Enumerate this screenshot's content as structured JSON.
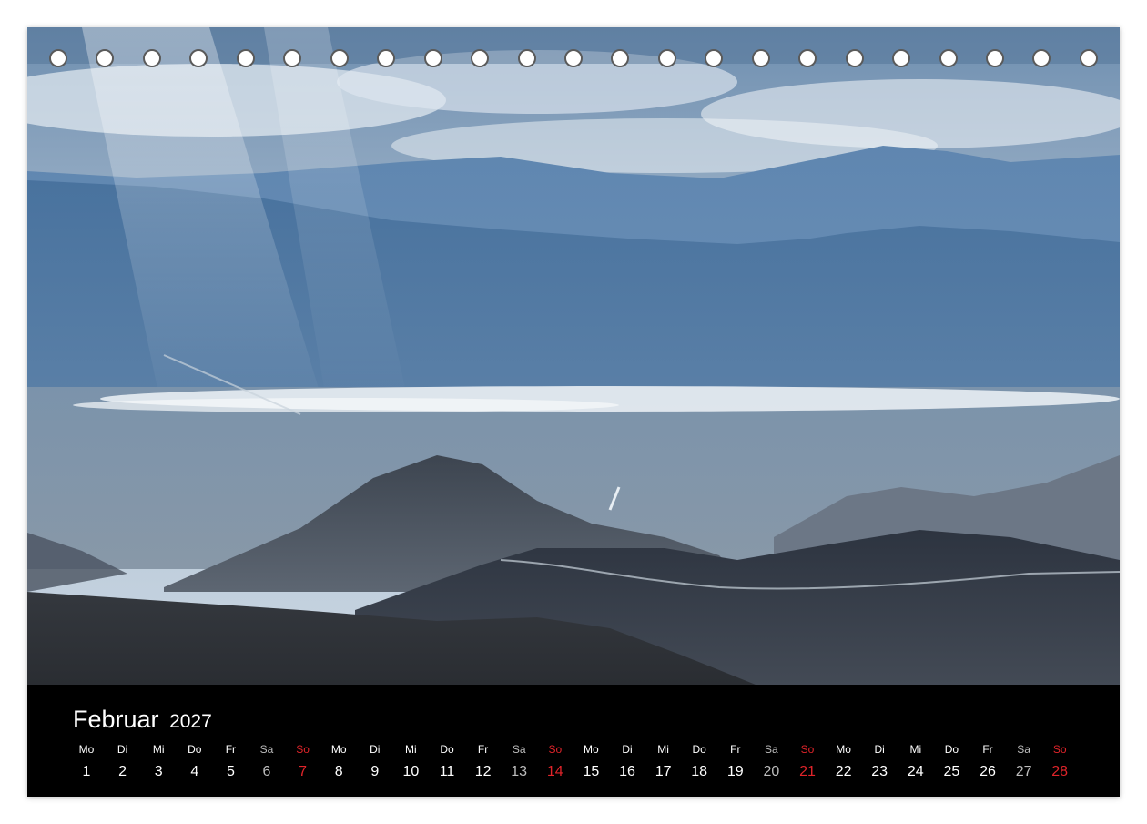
{
  "calendar": {
    "month": "Februar",
    "year": "2027",
    "colors": {
      "sunday": "#e0242a",
      "saturday": "#bdbdbd",
      "weekday": "#ffffff",
      "bar": "#000000"
    },
    "days": [
      {
        "wd": "Mo",
        "d": "1"
      },
      {
        "wd": "Di",
        "d": "2"
      },
      {
        "wd": "Mi",
        "d": "3"
      },
      {
        "wd": "Do",
        "d": "4"
      },
      {
        "wd": "Fr",
        "d": "5"
      },
      {
        "wd": "Sa",
        "d": "6"
      },
      {
        "wd": "So",
        "d": "7"
      },
      {
        "wd": "Mo",
        "d": "8"
      },
      {
        "wd": "Di",
        "d": "9"
      },
      {
        "wd": "Mi",
        "d": "10"
      },
      {
        "wd": "Do",
        "d": "11"
      },
      {
        "wd": "Fr",
        "d": "12"
      },
      {
        "wd": "Sa",
        "d": "13"
      },
      {
        "wd": "So",
        "d": "14"
      },
      {
        "wd": "Mo",
        "d": "15"
      },
      {
        "wd": "Di",
        "d": "16"
      },
      {
        "wd": "Mi",
        "d": "17"
      },
      {
        "wd": "Do",
        "d": "18"
      },
      {
        "wd": "Fr",
        "d": "19"
      },
      {
        "wd": "Sa",
        "d": "20"
      },
      {
        "wd": "So",
        "d": "21"
      },
      {
        "wd": "Mo",
        "d": "22"
      },
      {
        "wd": "Di",
        "d": "23"
      },
      {
        "wd": "Mi",
        "d": "24"
      },
      {
        "wd": "Do",
        "d": "25"
      },
      {
        "wd": "Fr",
        "d": "26"
      },
      {
        "wd": "Sa",
        "d": "27"
      },
      {
        "wd": "So",
        "d": "28"
      }
    ]
  }
}
